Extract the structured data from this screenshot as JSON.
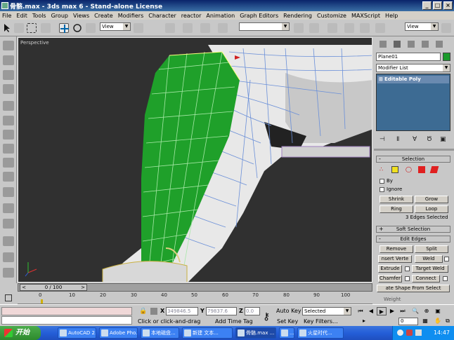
{
  "window": {
    "title": "骨骼.max - 3ds max 6 - Stand-alone License",
    "buttons": [
      "_",
      "□",
      "×"
    ]
  },
  "menu": [
    "File",
    "Edit",
    "Tools",
    "Group",
    "Views",
    "Create",
    "Modifiers",
    "Character",
    "reactor",
    "Animation",
    "Graph Editors",
    "Rendering",
    "Customize",
    "MAXScript",
    "Help"
  ],
  "toolbar": {
    "view_dropdown": "View",
    "view_dropdown_right": "View"
  },
  "viewport": {
    "label": "Perspective"
  },
  "command_panel": {
    "object_name": "Plane01",
    "object_color": "#1a9a2a",
    "modifier_list": "Modifier List",
    "stack_item": "Editable Poly",
    "selection": {
      "title": "Selection",
      "by_label": "By",
      "ignore_label": "Ignore",
      "shrink": "Shrink",
      "grow": "Grow",
      "ring": "Ring",
      "loop": "Loop",
      "status": "3 Edges Selected"
    },
    "soft_selection": {
      "title": "Soft Selection"
    },
    "edit_edges": {
      "title": "Edit Edges",
      "remove": "Remove",
      "split": "Split",
      "insert_vertex": "nsert Verte",
      "weld": "Weld",
      "extrude": "Extrude",
      "target_weld": "Target Weld",
      "chamfer": "Chamfer",
      "connect": "Connect",
      "create_shape": "ate Shape From Select",
      "weight": "Weight"
    }
  },
  "timeline": {
    "slider": "0 / 100",
    "ticks": [
      "0",
      "10",
      "20",
      "30",
      "40",
      "50",
      "60",
      "70",
      "80",
      "90",
      "100"
    ]
  },
  "status": {
    "x_label": "X",
    "x_value": "349846.5",
    "y_label": "Y",
    "y_value": "79837.6",
    "z_label": "Z",
    "z_value": "0.0",
    "auto_key": "Auto Key",
    "set_key": "Set Key",
    "anim_mode": "Selected",
    "key_filters": "Key Filters...",
    "frame": "0",
    "prompt": "Click or click-and-drag",
    "add_time_tag": "Add Time Tag"
  },
  "taskbar": {
    "start": "开始",
    "items": [
      "AutoCAD 2...",
      "Adobe Pho...",
      "本地磁盘...",
      "新建 文本...",
      "骨骼.max ...",
      "...",
      "火星时代..."
    ],
    "clock": "14:47"
  }
}
